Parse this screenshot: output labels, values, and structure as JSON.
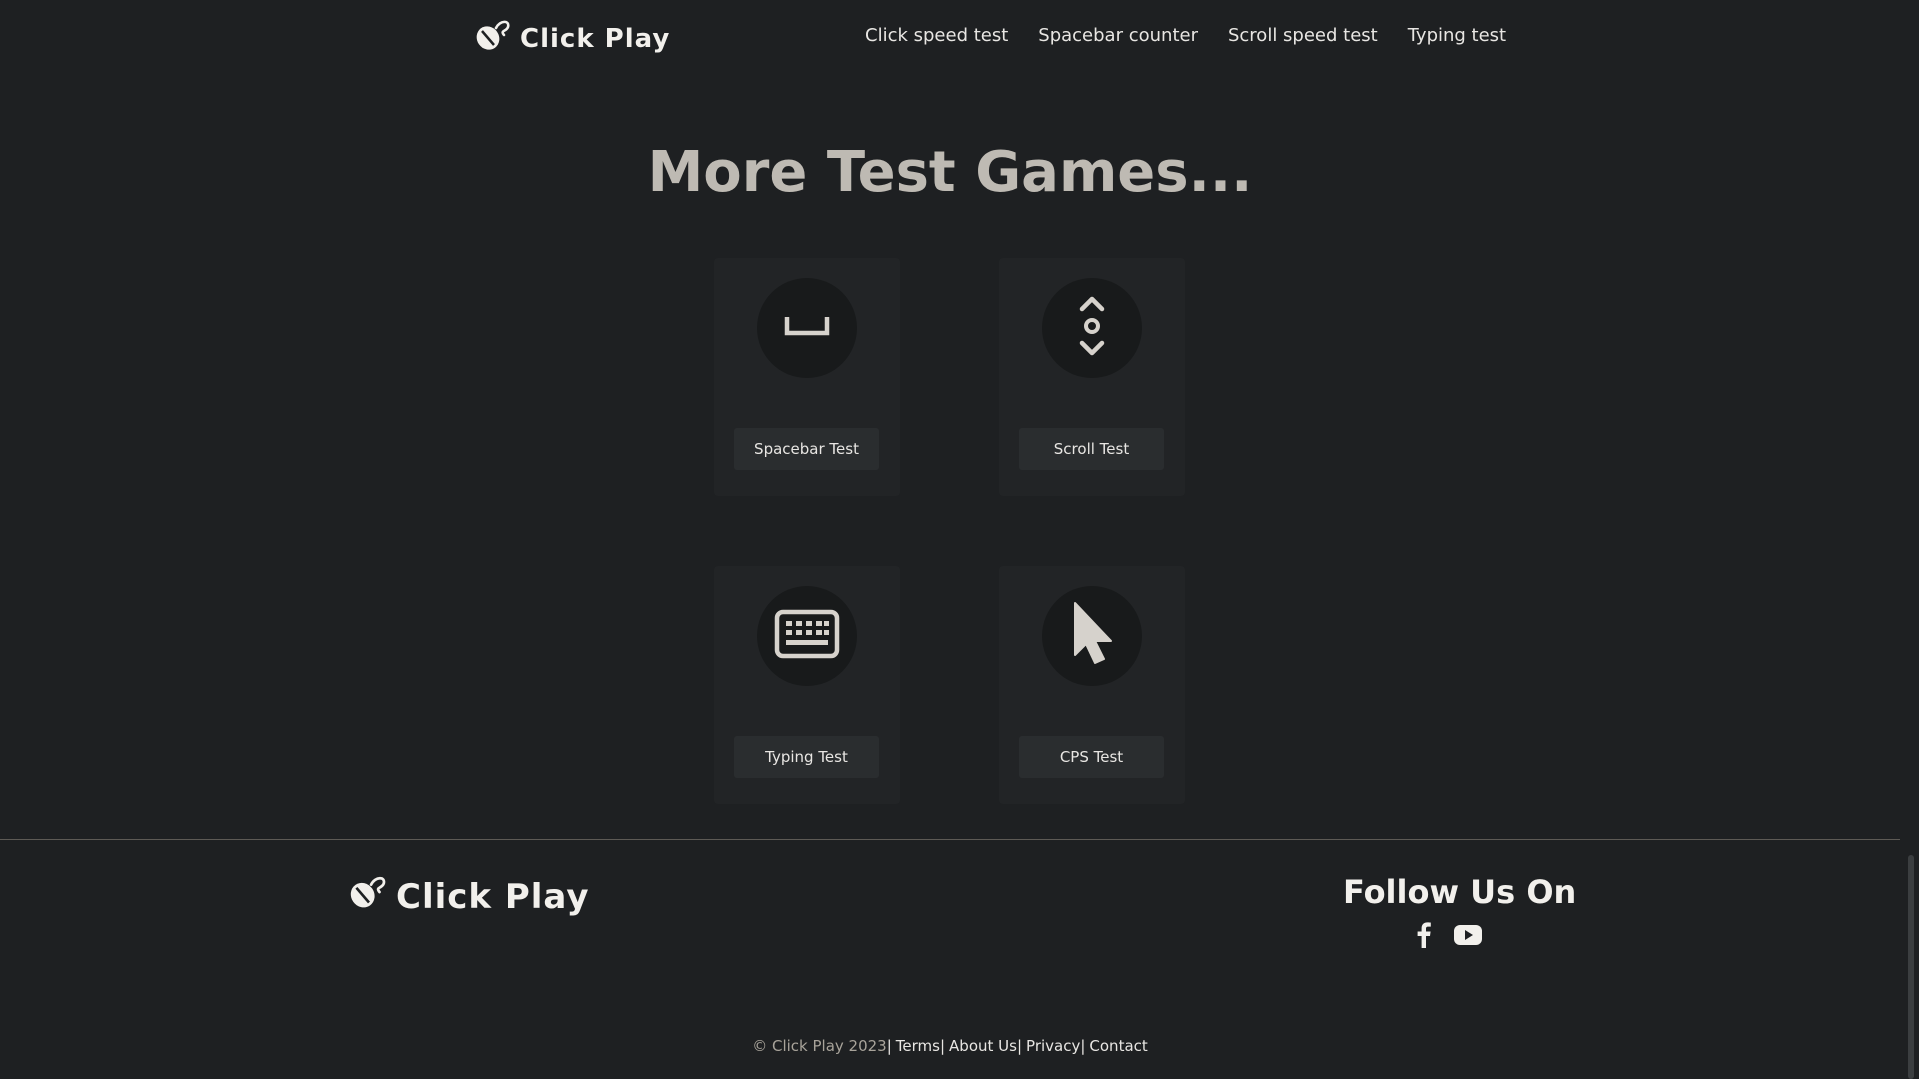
{
  "header": {
    "logo_text": "Click Play",
    "nav": [
      {
        "label": "Click speed test"
      },
      {
        "label": "Spacebar counter"
      },
      {
        "label": "Scroll speed test"
      },
      {
        "label": "Typing test"
      }
    ]
  },
  "section": {
    "title": "More Test Games...",
    "cards": [
      {
        "label": "Spacebar Test",
        "icon": "spacebar-icon"
      },
      {
        "label": "Scroll Test",
        "icon": "scroll-icon"
      },
      {
        "label": "Typing Test",
        "icon": "keyboard-icon"
      },
      {
        "label": "CPS Test",
        "icon": "cursor-icon"
      }
    ]
  },
  "footer": {
    "logo_text": "Click Play",
    "follow_title": "Follow Us On",
    "social": [
      {
        "icon": "facebook-icon"
      },
      {
        "icon": "youtube-icon"
      }
    ],
    "copyright": "© Click Play 2023",
    "links": [
      {
        "label": "Terms"
      },
      {
        "label": "About Us"
      },
      {
        "label": "Privacy"
      },
      {
        "label": "Contact"
      }
    ]
  },
  "colors": {
    "background": "#1e2022",
    "card": "#222426",
    "icon_circle": "#181a1b",
    "title": "#bebab3",
    "text": "#e8e6e3"
  }
}
